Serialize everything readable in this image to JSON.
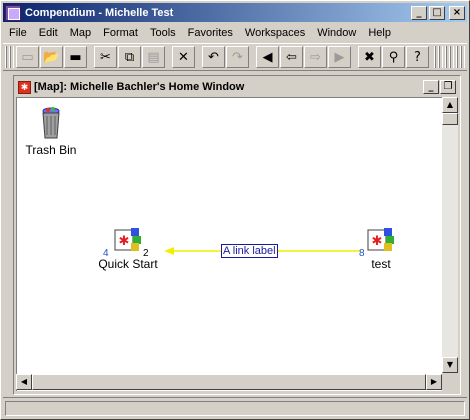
{
  "window": {
    "title": "Compendium - Michelle Test",
    "controls": {
      "minimize": "_",
      "maximize": "□",
      "close": "×"
    }
  },
  "menu": [
    "File",
    "Edit",
    "Map",
    "Format",
    "Tools",
    "Favorites",
    "Workspaces",
    "Window",
    "Help"
  ],
  "toolbar": {
    "buttons": [
      {
        "name": "new-button",
        "icon": "new-document-icon",
        "glyph": "▭",
        "enabled": false
      },
      {
        "name": "open-button",
        "icon": "open-folder-icon",
        "glyph": "📂",
        "enabled": true
      },
      {
        "name": "save-button",
        "icon": "save-folder-icon",
        "glyph": "▬",
        "enabled": true
      },
      {
        "name": "cut-button",
        "icon": "scissors-icon",
        "glyph": "✂",
        "enabled": true
      },
      {
        "name": "copy-button",
        "icon": "copy-icon",
        "glyph": "⧉",
        "enabled": true
      },
      {
        "name": "paste-button",
        "icon": "paste-icon",
        "glyph": "▤",
        "enabled": false
      },
      {
        "name": "delete-button",
        "icon": "delete-x-icon",
        "glyph": "✕",
        "enabled": true
      },
      {
        "name": "undo-button",
        "icon": "undo-icon",
        "glyph": "↶",
        "enabled": true
      },
      {
        "name": "redo-button",
        "icon": "redo-icon",
        "glyph": "↷",
        "enabled": false
      },
      {
        "name": "back-button",
        "icon": "arrow-left-icon",
        "glyph": "◀",
        "enabled": true
      },
      {
        "name": "back-history-button",
        "icon": "arrow-left-block-icon",
        "glyph": "⇦",
        "enabled": true
      },
      {
        "name": "forward-history-button",
        "icon": "arrow-right-block-icon",
        "glyph": "⇨",
        "enabled": false
      },
      {
        "name": "forward-button",
        "icon": "arrow-right-icon",
        "glyph": "▶",
        "enabled": false
      },
      {
        "name": "close-view-button",
        "icon": "close-view-icon",
        "glyph": "✖",
        "enabled": true
      },
      {
        "name": "search-button",
        "icon": "binoculars-icon",
        "glyph": "⚲",
        "enabled": true
      },
      {
        "name": "help-button",
        "icon": "help-pointer-icon",
        "glyph": "?",
        "enabled": true
      }
    ]
  },
  "map_window": {
    "title": "[Map]:  Michelle Bachler's Home Window",
    "controls": {
      "minimize": "_",
      "restore": "❐"
    }
  },
  "nodes": {
    "trash": {
      "label": "Trash Bin"
    },
    "quick_start": {
      "label": "Quick Start",
      "count_left": "4",
      "count_right": "2"
    },
    "test": {
      "label": "test",
      "count_left": "8"
    }
  },
  "link": {
    "label": "A link label"
  },
  "colors": {
    "title_start": "#0a246a",
    "title_end": "#a6caf0",
    "link": "#f0f000",
    "link_text": "#1a1aa0"
  }
}
